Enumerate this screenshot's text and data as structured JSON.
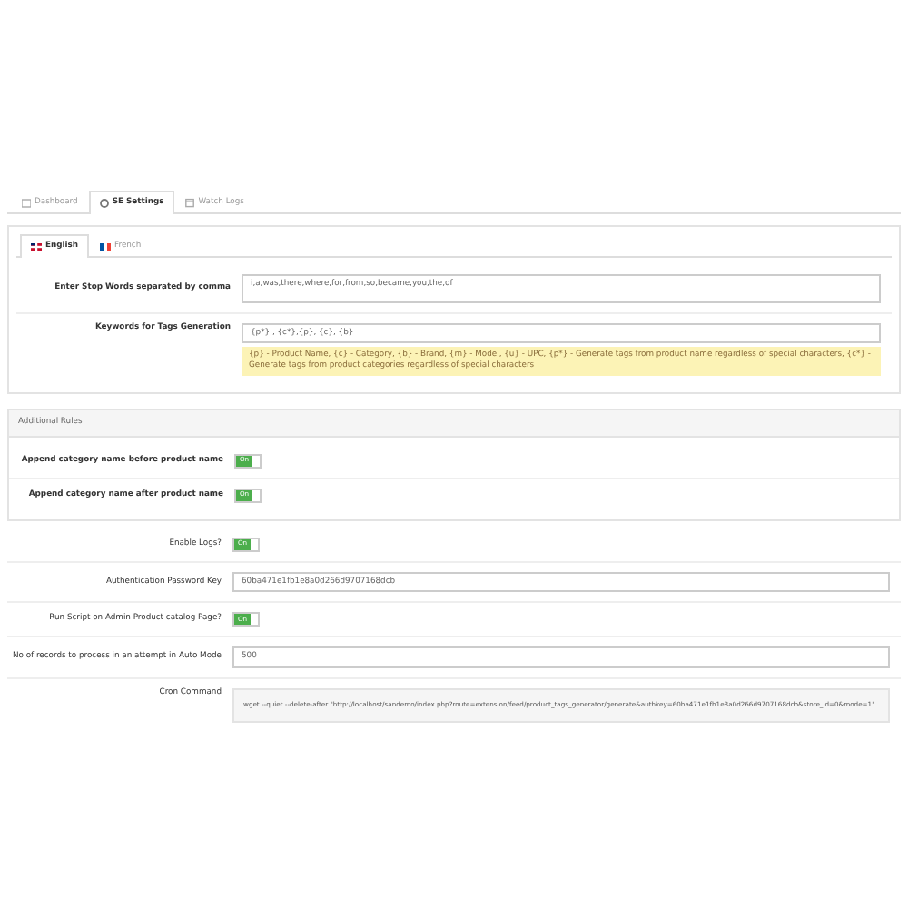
{
  "nav_tabs": [
    {
      "label": "Dashboard",
      "selected": false
    },
    {
      "label": "SE Settings",
      "selected": true
    },
    {
      "label": "Watch Logs",
      "selected": false
    }
  ],
  "language_tabs": [
    {
      "label": "English",
      "selected": true
    },
    {
      "label": "French",
      "selected": false
    }
  ],
  "fields": [
    {
      "kind": "textarea",
      "label": "Enter Stop Words separated by comma",
      "value": "i,a,was,there,where,for,from,so,became,you,the,of"
    },
    {
      "kind": "text",
      "label": "Keywords for Tags Generation",
      "value": "{p*} , {c*},{p}, {c}, {b}",
      "hint": "{p} - Product Name, {c} - Category, {b} - Brand, {m} - Model, {u} - UPC, {p*} - Generate tags from product name regardless of special characters, {c*} - Generate tags from product categories regardless of special characters"
    }
  ],
  "additional_rules": {
    "title": "Additional Rules",
    "rows": [
      {
        "label": "Append category name before product name",
        "switch_label": "On",
        "on": true
      },
      {
        "label": "Append category name after product name",
        "switch_label": "On",
        "on": true
      }
    ]
  },
  "settings": [
    {
      "kind": "switch",
      "label": "Enable Logs?",
      "switch_label": "On",
      "on": true
    },
    {
      "kind": "text",
      "label": "Authentication Password Key",
      "value": "60ba471e1fb1e8a0d266d9707168dcb"
    },
    {
      "kind": "switch",
      "label": "Run Script on Admin Product catalog Page?",
      "switch_label": "On",
      "on": true
    },
    {
      "kind": "text",
      "label": "No of records to process in an attempt in Auto Mode",
      "value": "500"
    },
    {
      "kind": "code",
      "label": "Cron Command",
      "value": "wget --quiet --delete-after \"http://localhost/sandemo/index.php?route=extension/feed/product_tags_generator/generate&authkey=60ba471e1fb1e8a0d266d9707168dcb&store_id=0&mode=1\""
    }
  ]
}
